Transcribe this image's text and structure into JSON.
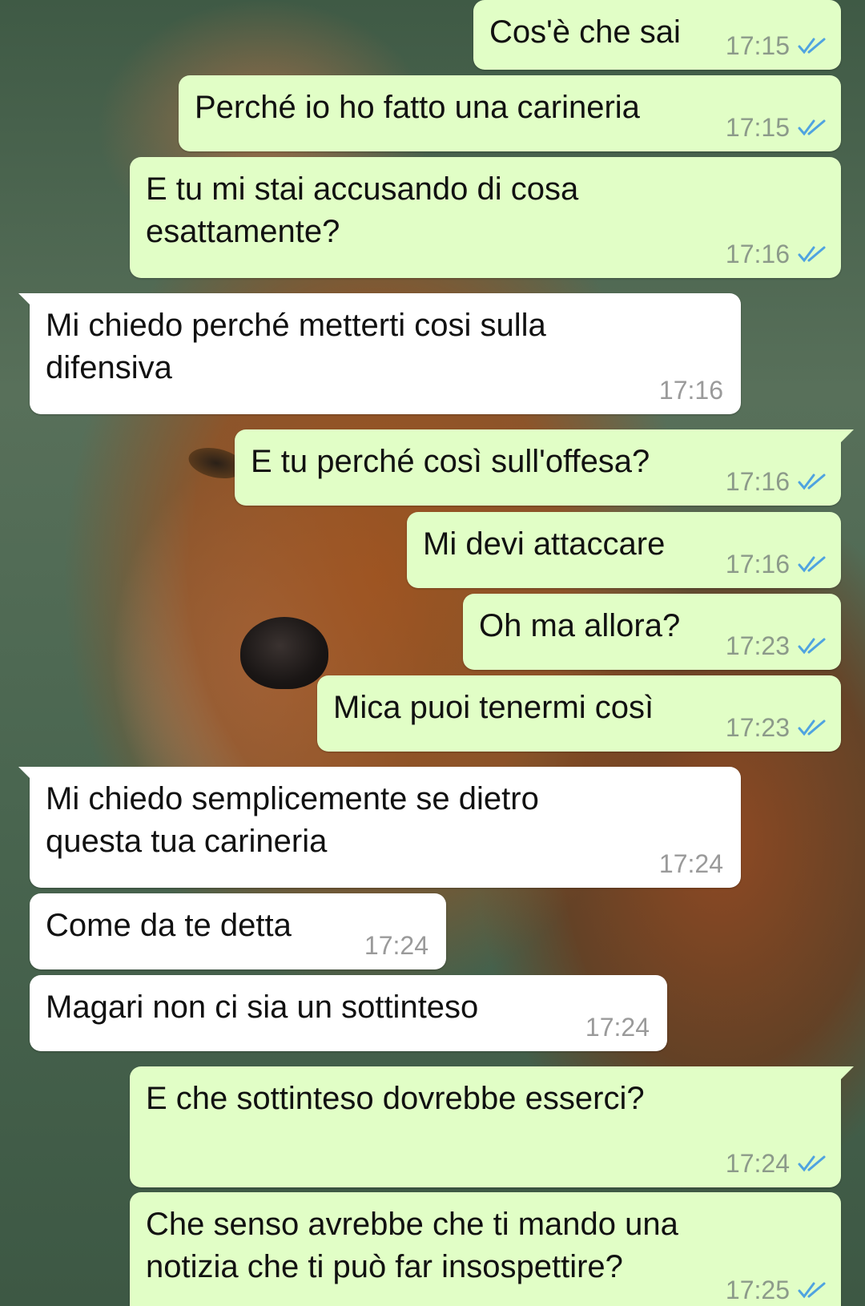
{
  "chat": {
    "messages": [
      {
        "direction": "out",
        "text": "Cos'è che sai",
        "time": "17:15",
        "status": "read"
      },
      {
        "direction": "out",
        "text": "Perché io ho fatto una carineria",
        "time": "17:15",
        "status": "read"
      },
      {
        "direction": "out",
        "text": "E tu mi stai accusando di cosa\nesattamente?",
        "time": "17:16",
        "status": "read"
      },
      {
        "direction": "in",
        "text": "Mi chiedo perché metterti cosi sulla\ndifensiva",
        "time": "17:16"
      },
      {
        "direction": "out",
        "text": "E tu perché così sull'offesa?",
        "time": "17:16",
        "status": "read"
      },
      {
        "direction": "out",
        "text": "Mi devi attaccare",
        "time": "17:16",
        "status": "read"
      },
      {
        "direction": "out",
        "text": "Oh ma allora?",
        "time": "17:23",
        "status": "read"
      },
      {
        "direction": "out",
        "text": "Mica puoi tenermi così",
        "time": "17:23",
        "status": "read"
      },
      {
        "direction": "in",
        "text": "Mi chiedo semplicemente se dietro\nquesta tua carineria",
        "time": "17:24"
      },
      {
        "direction": "in",
        "text": "Come da te detta",
        "time": "17:24"
      },
      {
        "direction": "in",
        "text": "Magari non ci sia un sottinteso",
        "time": "17:24"
      },
      {
        "direction": "out",
        "text": "E che sottinteso dovrebbe esserci?",
        "time": "17:24",
        "status": "read"
      },
      {
        "direction": "out",
        "text": "Che senso avrebbe che ti mando una\nnotizia che ti può far insospettire?",
        "time": "17:25",
        "status": "read"
      }
    ],
    "colors": {
      "outgoing_bubble": "#e1fec6",
      "incoming_bubble": "#ffffff",
      "read_tick": "#4fa3e0",
      "timestamp": "#8c9a8a"
    },
    "icons": {
      "read_status": "double-check-icon"
    }
  }
}
